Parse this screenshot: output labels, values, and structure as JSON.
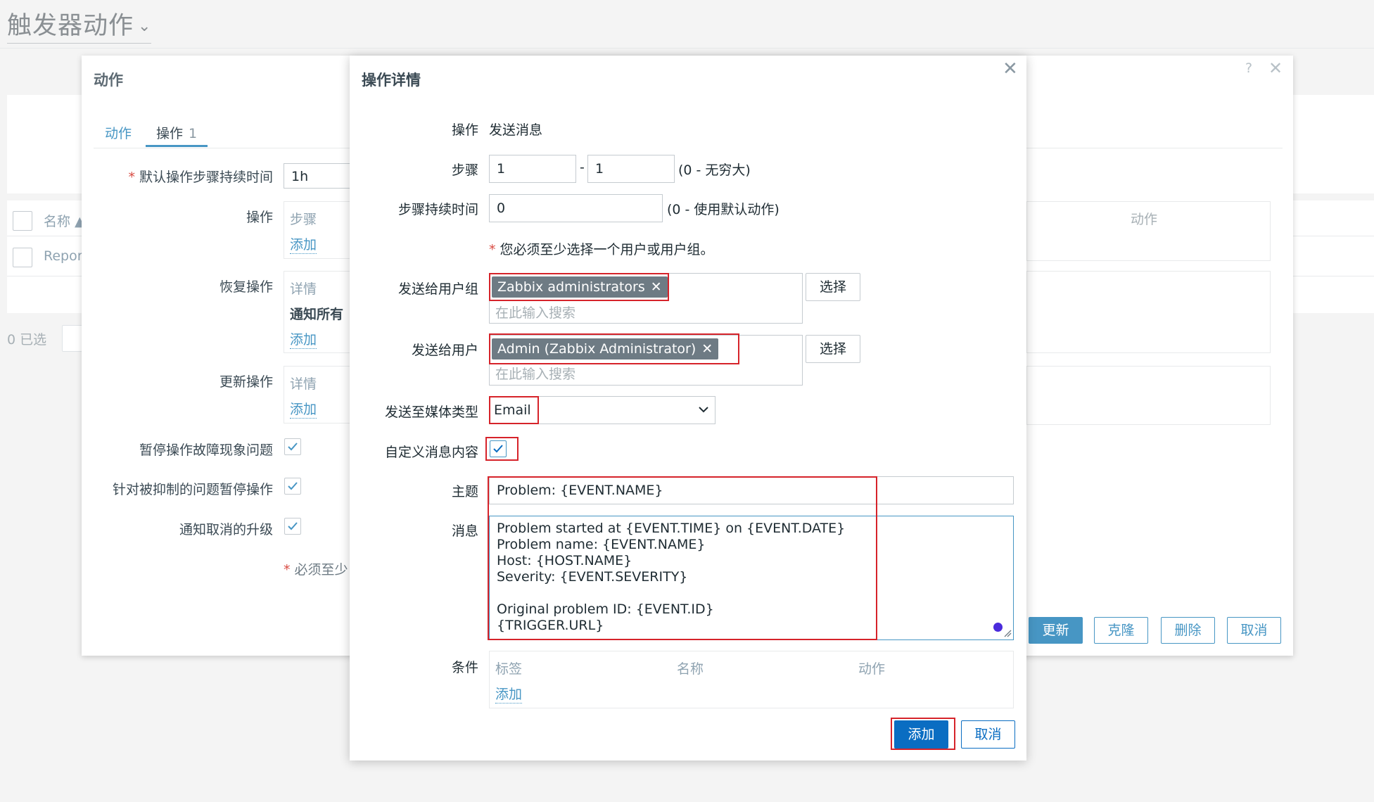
{
  "page": {
    "title": "触发器动作"
  },
  "background": {
    "col_name": "名称",
    "row_name": "Repor",
    "selected": "0 已选"
  },
  "action_dialog": {
    "title": "动作",
    "help_icon": "?",
    "tabs": [
      {
        "label": "动作"
      },
      {
        "label": "操作",
        "count": "1"
      }
    ],
    "default_step_duration": {
      "label": "默认操作步骤持续时间",
      "value": "1h"
    },
    "operations": {
      "label": "操作",
      "col_steps": "步骤",
      "add": "添加"
    },
    "recovery_operations": {
      "label": "恢复操作",
      "col_details": "详情",
      "row_text": "通知所有",
      "add": "添加"
    },
    "update_operations": {
      "label": "更新操作",
      "col_details": "详情",
      "add": "添加"
    },
    "pause_problem": {
      "label": "暂停操作故障现象问题",
      "checked": true
    },
    "pause_suppressed": {
      "label": "针对被抑制的问题暂停操作",
      "checked": true
    },
    "notify_cancel": {
      "label": "通知取消的升级",
      "checked": true
    },
    "footnote": "必须至少",
    "right_col_header": "动作",
    "buttons": {
      "update": "更新",
      "clone": "克隆",
      "delete": "删除",
      "cancel": "取消"
    }
  },
  "op_dialog": {
    "title": "操作详情",
    "operation": {
      "label": "操作",
      "value": "发送消息"
    },
    "steps": {
      "label": "步骤",
      "from": "1",
      "sep": "-",
      "to": "1",
      "hint": "(0 - 无穷大)"
    },
    "step_duration": {
      "label": "步骤持续时间",
      "value": "0",
      "hint": "(0 - 使用默认动作)"
    },
    "required_note": "您必须至少选择一个用户或用户组。",
    "send_groups": {
      "label": "发送给用户组",
      "chip": "Zabbix administrators",
      "placeholder": "在此输入搜索",
      "select": "选择"
    },
    "send_users": {
      "label": "发送给用户",
      "chip": "Admin (Zabbix Administrator)",
      "placeholder": "在此输入搜索",
      "select": "选择"
    },
    "media_type": {
      "label": "发送至媒体类型",
      "value": "Email"
    },
    "custom_message": {
      "label": "自定义消息内容",
      "checked": true
    },
    "subject": {
      "label": "主题",
      "value": "Problem: {EVENT.NAME}"
    },
    "message": {
      "label": "消息",
      "lines": [
        "Problem started at {EVENT.TIME} on {EVENT.DATE}",
        "Problem name: {EVENT.NAME}",
        "Host: {HOST.NAME}",
        "Severity: {EVENT.SEVERITY}",
        "",
        "Original problem ID: {EVENT.ID}",
        "{TRIGGER.URL}"
      ]
    },
    "conditions": {
      "label": "条件",
      "col_tag": "标签",
      "col_name": "名称",
      "col_action": "动作",
      "add": "添加"
    },
    "buttons": {
      "add": "添加",
      "cancel": "取消"
    }
  },
  "colors": {
    "accent": "#0a6dc2",
    "link": "#4796c4",
    "highlight": "#d6232a"
  }
}
